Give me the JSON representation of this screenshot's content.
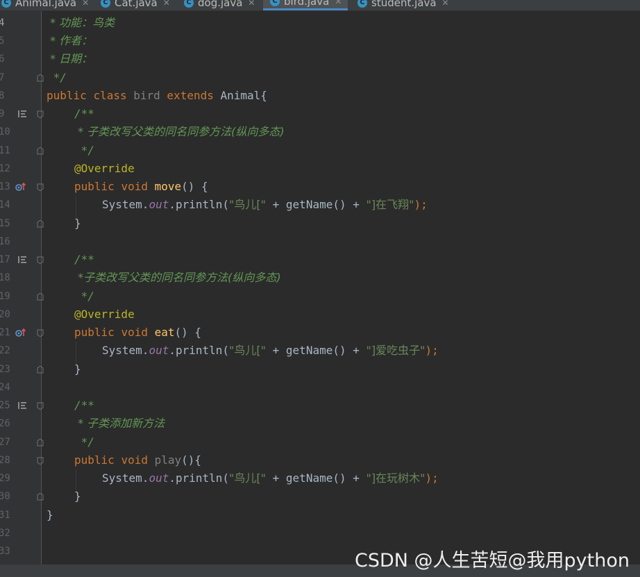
{
  "tabs": [
    {
      "label": "Animal.java",
      "active": false
    },
    {
      "label": "Cat.java",
      "active": false
    },
    {
      "label": "dog.java",
      "active": false
    },
    {
      "label": "bird.java",
      "active": true
    },
    {
      "label": "student.java",
      "active": false
    }
  ],
  "gutter": {
    "line_numbers": [
      "4",
      "5",
      "6",
      "7",
      "8",
      "9",
      "10",
      "11",
      "12",
      "13",
      "14",
      "15",
      "16",
      "17",
      "18",
      "19",
      "20",
      "21",
      "22",
      "23",
      "24",
      "25",
      "26",
      "27",
      "28",
      "29",
      "30",
      "31",
      "32",
      "33"
    ]
  },
  "code": {
    "l4_comment": " * 功能：鸟类",
    "l5_comment": " * 作者：",
    "l6_comment": " * 日期：",
    "l7_comment": " */",
    "l8_public": "public",
    "l8_class": "class",
    "l8_name": "bird",
    "l8_extends": "extends",
    "l8_parent": "Animal{",
    "l9_comment": "/**",
    "l10_comment": " * 子类改写父类的同名同参方法(纵向多态)",
    "l11_comment": " */",
    "l12_annotation": "@Override",
    "l13_public": "public",
    "l13_void": "void",
    "l13_method": "move",
    "l13_rest": "() {",
    "l14_system": "System.",
    "l14_out": "out",
    "l14_println": ".println(",
    "l14_str1": "\"鸟儿[\"",
    "l14_plus1": " + getName() + ",
    "l14_str2": "\"]在飞翔\"",
    "l14_end": ");",
    "l15_brace": "}",
    "l17_comment": "/**",
    "l18_comment": " *子类改写父类的同名同参方法(纵向多态)",
    "l19_comment": " */",
    "l20_annotation": "@Override",
    "l21_public": "public",
    "l21_void": "void",
    "l21_method": "eat",
    "l21_rest": "() {",
    "l22_system": "System.",
    "l22_out": "out",
    "l22_println": ".println(",
    "l22_str1": "\"鸟儿[\"",
    "l22_plus1": " + getName() + ",
    "l22_str2": "\"]爱吃虫子\"",
    "l22_end": ");",
    "l23_brace": "}",
    "l25_comment": "/**",
    "l26_comment": " * 子类添加新方法",
    "l27_comment": " */",
    "l28_public": "public",
    "l28_void": "void",
    "l28_method": "play",
    "l28_rest": "(){",
    "l29_system": "System.",
    "l29_out": "out",
    "l29_println": ".println(",
    "l29_str1": "\"鸟儿[\"",
    "l29_plus1": " + getName() + ",
    "l29_str2": "\"]在玩树木\"",
    "l29_end": ");",
    "l30_brace": "}",
    "l31_brace": "}"
  },
  "watermark": "CSDN @人生苦短@我用python",
  "colors": {
    "background": "#2b2b2b",
    "gutter": "#313335",
    "keyword": "#cc7832",
    "annotation": "#bbb529",
    "comment": "#629755",
    "string": "#6a8759",
    "method": "#ffc66d",
    "field": "#9876aa",
    "plain": "#a9b7c6"
  }
}
